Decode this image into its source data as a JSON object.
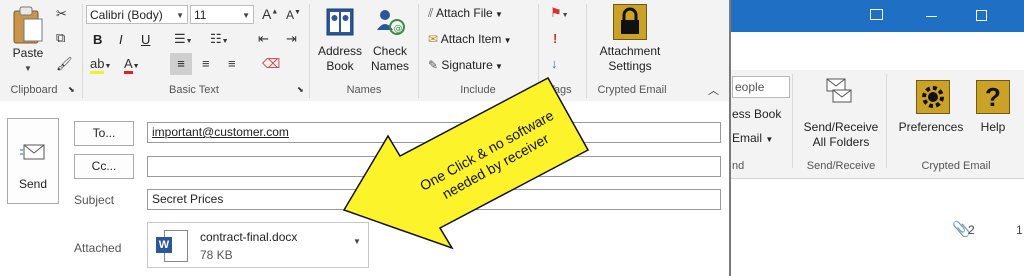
{
  "ribbon": {
    "clipboard": {
      "paste_label": "Paste",
      "group_label": "Clipboard"
    },
    "basic_text": {
      "font_name": "Calibri (Body)",
      "font_size": "11",
      "group_label": "Basic Text"
    },
    "names": {
      "address_book_line1": "Address",
      "address_book_line2": "Book",
      "check_names_line1": "Check",
      "check_names_line2": "Names",
      "group_label": "Names"
    },
    "include": {
      "attach_file": "Attach File",
      "attach_item": "Attach Item",
      "signature": "Signature",
      "group_label": "Include"
    },
    "tags": {
      "group_label": "Tags"
    },
    "crypted_email": {
      "attachment_settings_line1": "Attachment",
      "attachment_settings_line2": "Settings",
      "group_label": "Crypted Email"
    }
  },
  "main_window": {
    "search_people_placeholder": "eople",
    "address_book_partial": "ess Book",
    "email_partial": "Email",
    "find_group_partial": "nd",
    "send_receive_line1": "Send/Receive",
    "send_receive_line2": "All Folders",
    "send_receive_group": "Send/Receive",
    "preferences": "Preferences",
    "help": "Help",
    "crypted_group": "Crypted Email",
    "attachment_count": "2",
    "count_partial": "1"
  },
  "compose": {
    "send_label": "Send",
    "to_button": "To...",
    "to_value": "important@customer.com",
    "cc_button": "Cc...",
    "cc_value": "",
    "subject_label": "Subject",
    "subject_value": "Secret Prices",
    "attached_label": "Attached",
    "attachment_name": "contract-final.docx",
    "attachment_size": "78 KB"
  },
  "callout": {
    "line1": "One Click & no software",
    "line2": "needed by receiver",
    "fill": "#fdf32b",
    "stroke": "#111111"
  },
  "colors": {
    "titlebar": "#1f6fc5",
    "word_icon": "#2b579a",
    "lock_gold": "#c9a227"
  }
}
